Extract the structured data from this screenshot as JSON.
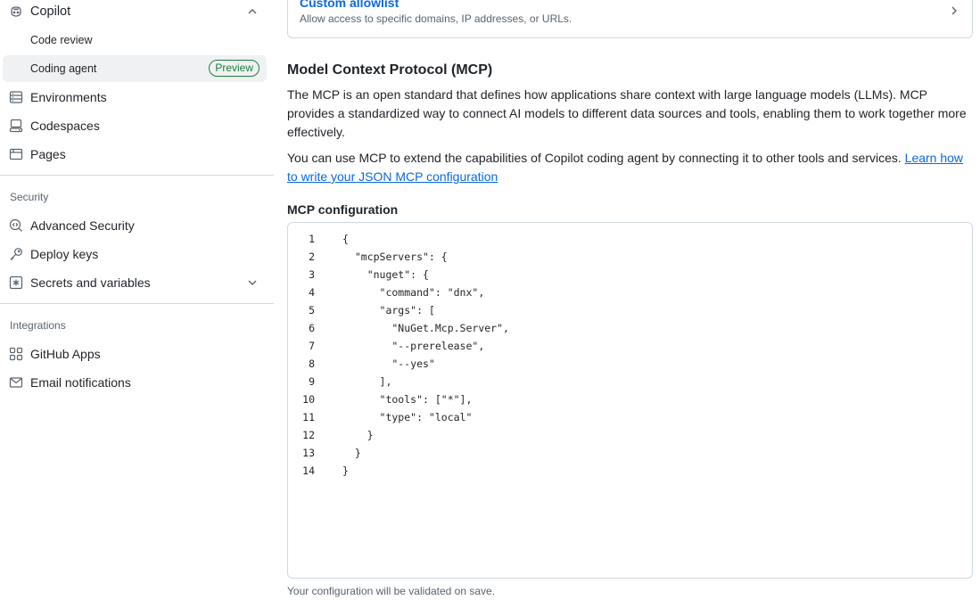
{
  "sidebar": {
    "copilot": {
      "label": "Copilot",
      "icon": "copilot-icon",
      "expanded": true
    },
    "copilot_children": [
      {
        "label": "Code review"
      },
      {
        "label": "Coding agent",
        "badge": "Preview",
        "active": true
      }
    ],
    "items_top": [
      {
        "label": "Environments",
        "icon": "server-icon"
      },
      {
        "label": "Codespaces",
        "icon": "codespaces-icon"
      },
      {
        "label": "Pages",
        "icon": "browser-icon"
      }
    ],
    "security_heading": "Security",
    "security_items": [
      {
        "label": "Advanced Security",
        "icon": "codescan-icon"
      },
      {
        "label": "Deploy keys",
        "icon": "key-icon"
      },
      {
        "label": "Secrets and variables",
        "icon": "asterisk-icon",
        "expandable": true
      }
    ],
    "integrations_heading": "Integrations",
    "integrations_items": [
      {
        "label": "GitHub Apps",
        "icon": "apps-icon"
      },
      {
        "label": "Email notifications",
        "icon": "mail-icon"
      }
    ]
  },
  "main": {
    "allowlist": {
      "title": "Custom allowlist",
      "description": "Allow access to specific domains, IP addresses, or URLs."
    },
    "mcp_heading": "Model Context Protocol (MCP)",
    "mcp_paragraph": "The MCP is an open standard that defines how applications share context with large language models (LLMs). MCP provides a standardized way to connect AI models to different data sources and tools, enabling them to work together more effectively.",
    "usage_paragraph": "You can use MCP to extend the capabilities of Copilot coding agent by connecting it to other tools and services. ",
    "usage_link": "Learn how to write your JSON MCP configuration",
    "config_label": "MCP configuration",
    "code_lines": [
      "{",
      "  \"mcpServers\": {",
      "    \"nuget\": {",
      "      \"command\": \"dnx\",",
      "      \"args\": [",
      "        \"NuGet.Mcp.Server\",",
      "        \"--prerelease\",",
      "        \"--yes\"",
      "      ],",
      "      \"tools\": [\"*\"],",
      "      \"type\": \"local\"",
      "    }",
      "  }",
      "}"
    ],
    "footer_note": "Your configuration will be validated on save."
  }
}
